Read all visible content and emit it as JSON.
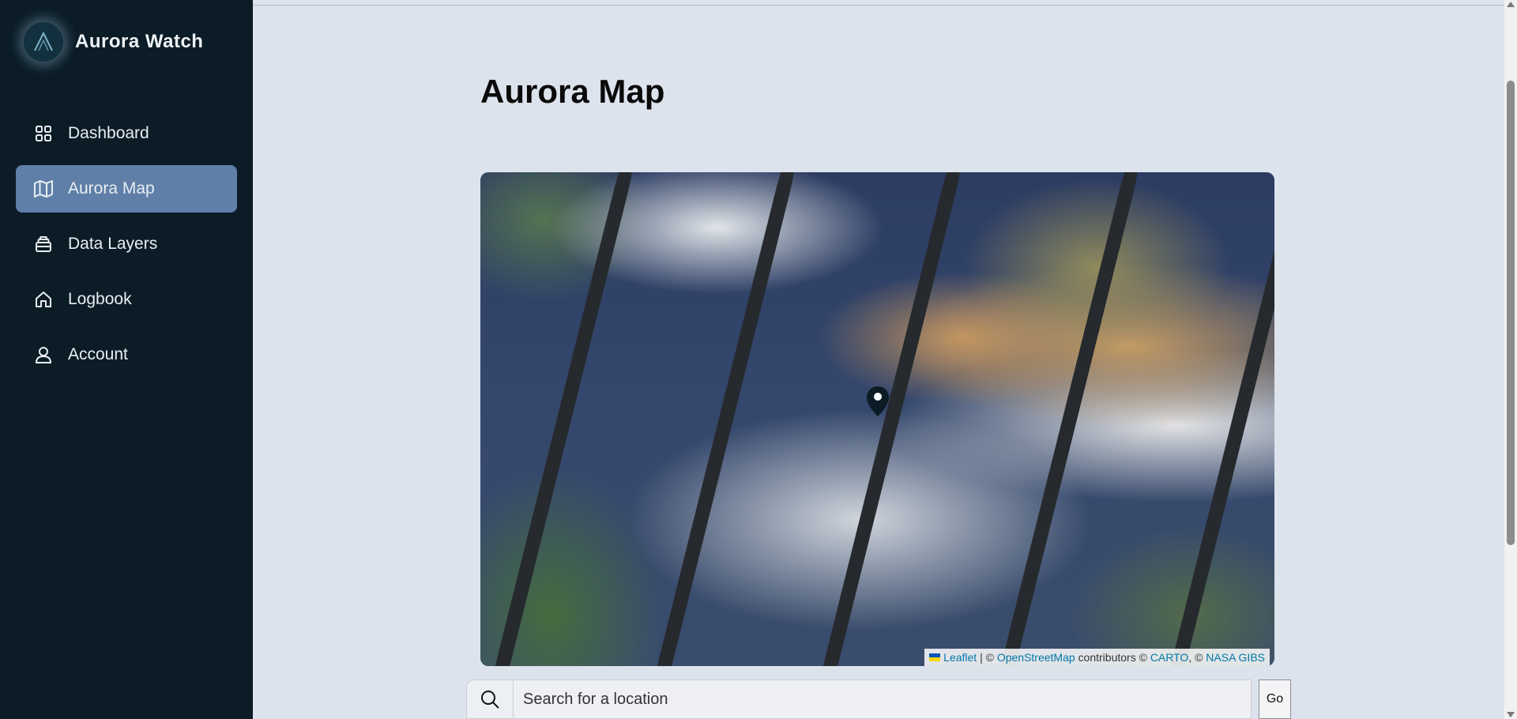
{
  "brand": {
    "name": "Aurora Watch",
    "logo_icon": "aurora-a-logo"
  },
  "sidebar": {
    "items": [
      {
        "label": "Dashboard",
        "icon": "grid-icon",
        "active": false
      },
      {
        "label": "Aurora Map",
        "icon": "map-icon",
        "active": true
      },
      {
        "label": "Data Layers",
        "icon": "layers-icon",
        "active": false
      },
      {
        "label": "Logbook",
        "icon": "home-icon",
        "active": false
      },
      {
        "label": "Account",
        "icon": "user-icon",
        "active": false
      }
    ]
  },
  "main": {
    "title": "Aurora Map",
    "map": {
      "attribution": {
        "leaflet": "Leaflet",
        "separator": " | © ",
        "osm": "OpenStreetMap",
        "contributors": " contributors © ",
        "carto": "CARTO",
        "comma": ", © ",
        "nasa": "NASA GIBS"
      },
      "marker_icon": "map-pin-icon"
    },
    "search": {
      "placeholder": "Search for a location",
      "value": "",
      "button_label": "Go"
    }
  },
  "colors": {
    "sidebar_bg": "#0b1c26",
    "active_item": "#5f7fa8",
    "page_bg": "#dde3ed"
  }
}
